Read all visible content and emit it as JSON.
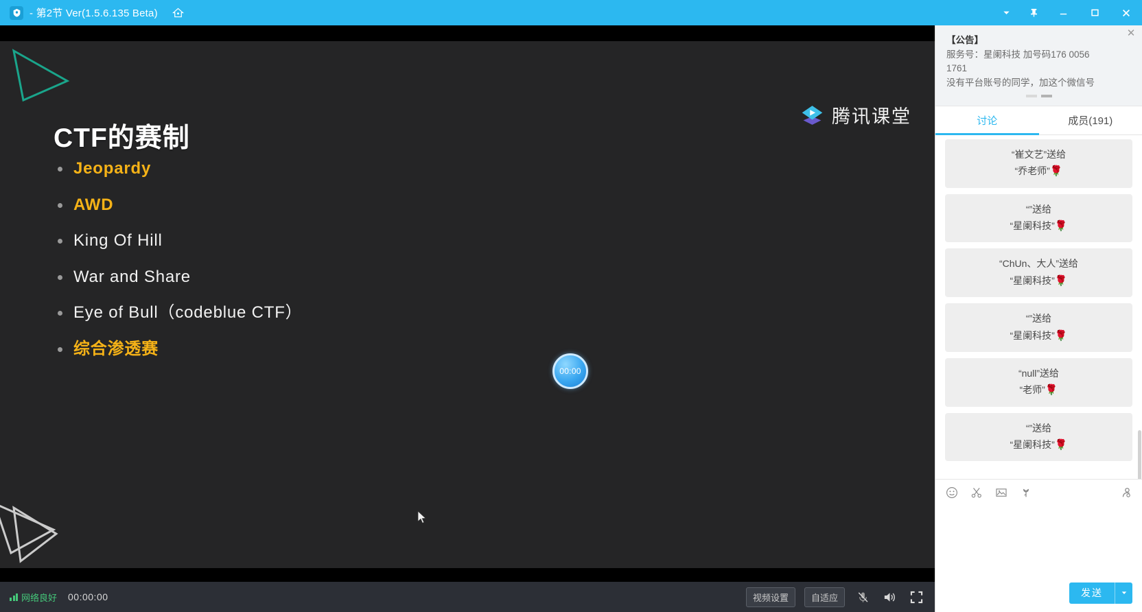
{
  "titlebar": {
    "title": "- 第2节 Ver(1.5.6.135 Beta)",
    "logo_icon": "app-shield-icon",
    "home_icon": "home-icon",
    "dropdown_icon": "chevron-down-icon",
    "pin_icon": "pin-icon",
    "minimize_icon": "minimize-icon",
    "maximize_icon": "maximize-icon",
    "close_icon": "close-icon",
    "bg_color": "#2cb8f0"
  },
  "slide": {
    "title": "CTF的赛制",
    "bullets": [
      {
        "text": "Jeopardy",
        "accent": true
      },
      {
        "text": "AWD",
        "accent": true
      },
      {
        "text": "King Of Hill",
        "accent": false
      },
      {
        "text": "War and Share",
        "accent": false
      },
      {
        "text": "Eye of Bull（codeblue CTF）",
        "accent": false
      },
      {
        "text": "综合渗透赛",
        "accent": true
      }
    ],
    "brand_text": "腾讯课堂",
    "brand_icon": "graduation-cap-play-icon",
    "accent_color": "#f5b217",
    "bg_color": "#252526",
    "teal_color": "#1aa58b",
    "timer_badge": "00:00"
  },
  "player": {
    "network_label": "网络良好",
    "network_color": "#45c87a",
    "network_icon": "signal-bars-icon",
    "elapsed": "00:00:00",
    "video_settings_label": "视频设置",
    "quality_label": "自适应",
    "mic_icon": "microphone-muted-icon",
    "speaker_icon": "speaker-on-icon",
    "fullscreen_icon": "fullscreen-icon"
  },
  "panel": {
    "notice": {
      "close_icon": "close-icon",
      "title": "【公告】",
      "body": "服务号：星阑科技  加号码176 0056 1761\n没有平台账号的同学，加这个微信号",
      "line1": "服务号：星阑科技  加号码176 0056",
      "line2": "1761",
      "line3": "没有平台账号的同学，加这个微信号"
    },
    "tabs": [
      {
        "label": "讨论",
        "active": true
      },
      {
        "label": "成员(191)",
        "active": false
      }
    ],
    "messages": [
      {
        "line1": "“崔文艺”送给",
        "line2": "“乔老师”",
        "gift": "🌹"
      },
      {
        "line1": "“”送给",
        "line2": "“星阑科技”",
        "gift": "🌹"
      },
      {
        "line1": "“ChUn、大人”送给",
        "line2": "“星阑科技”",
        "gift": "🌹"
      },
      {
        "line1": "“”送给",
        "line2": "“星阑科技”",
        "gift": "🌹"
      },
      {
        "line1": "“null”送给",
        "line2": "“老师”",
        "gift": "🌹"
      },
      {
        "line1": "“”送给",
        "line2": "“星阑科技”",
        "gift": "🌹"
      }
    ],
    "tools": [
      {
        "icon": "emoji-icon"
      },
      {
        "icon": "scissors-icon"
      },
      {
        "icon": "image-icon"
      },
      {
        "icon": "flower-icon"
      },
      {
        "icon": "user-icon"
      }
    ],
    "composer_placeholder": "",
    "composer_value": "",
    "send_label": "发送",
    "send_arrow_icon": "chevron-down-icon",
    "accent_color": "#2cb8f0"
  }
}
